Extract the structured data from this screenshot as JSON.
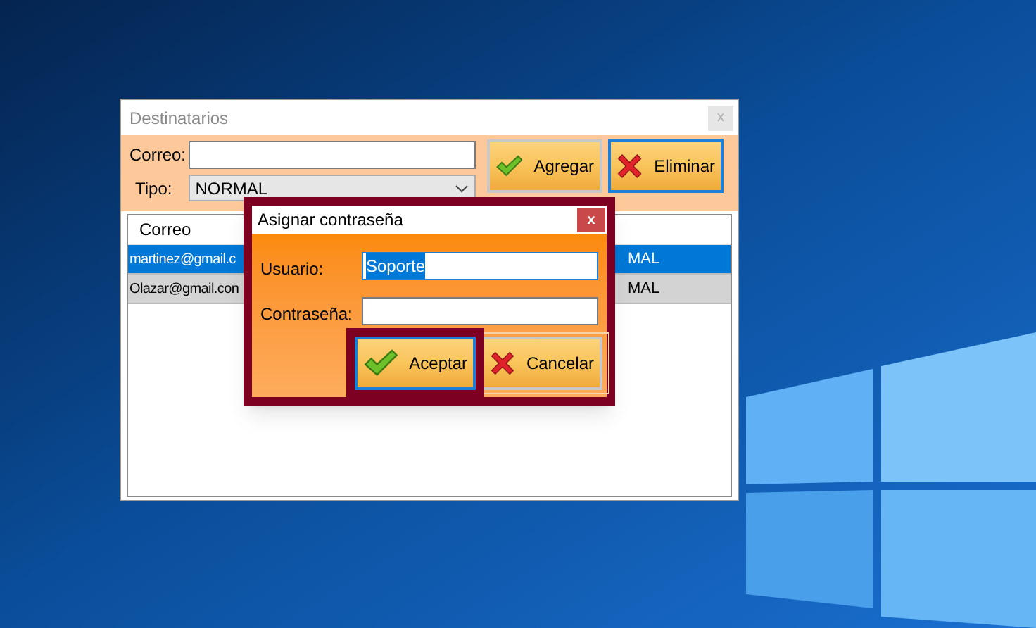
{
  "main_window": {
    "title": "Destinatarios",
    "close_label": "x",
    "correo_field": {
      "label": "Correo:"
    },
    "tipo_field": {
      "label": "Tipo:",
      "value": "NORMAL"
    },
    "buttons": [
      {
        "label": "Agregar",
        "kind": "check",
        "focused": false
      },
      {
        "label": "Eliminar",
        "kind": "cross",
        "focused": true
      }
    ],
    "table": {
      "columns": [
        "Correo"
      ],
      "rows": [
        {
          "cells": [
            "martinez@gmail.c",
            "MAL"
          ],
          "selected": true
        },
        {
          "cells": [
            "Olazar@gmail.con",
            "MAL"
          ],
          "selected": false
        }
      ]
    }
  },
  "dialog": {
    "title": "Asignar contraseña",
    "close_label": "x",
    "fields": [
      {
        "label": "Usuario:",
        "value": "Soporte",
        "text_selected": true
      },
      {
        "label": "Contraseña:",
        "text_selected": false
      }
    ],
    "buttons": [
      {
        "label": "Aceptar",
        "kind": "check",
        "focused": true
      },
      {
        "label": "Cancelar",
        "kind": "cross",
        "focused": false
      }
    ]
  }
}
